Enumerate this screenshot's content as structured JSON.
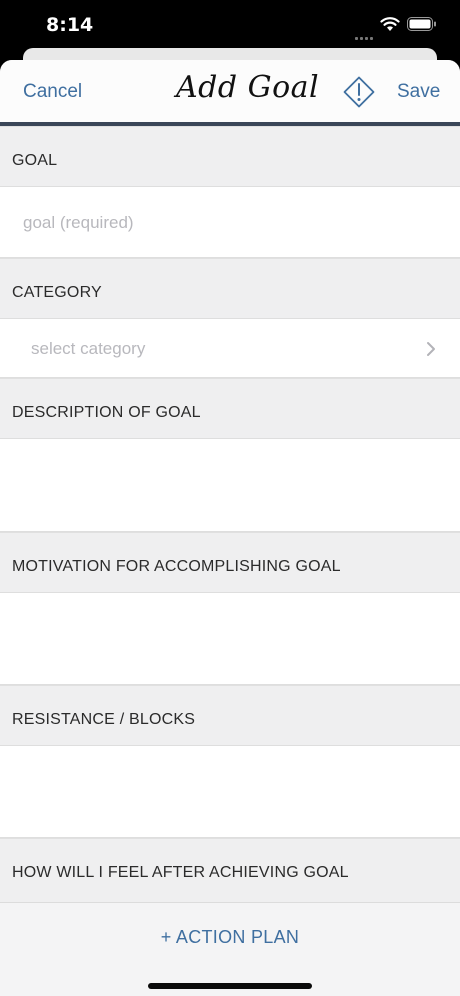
{
  "status": {
    "time": "8:14"
  },
  "nav": {
    "cancel": "Cancel",
    "title": "Add Goal",
    "save": "Save"
  },
  "sections": {
    "goal": {
      "header": "GOAL",
      "placeholder": "goal (required)"
    },
    "category": {
      "header": "CATEGORY",
      "placeholder": "select category"
    },
    "description": {
      "header": "DESCRIPTION OF GOAL"
    },
    "motivation": {
      "header": "MOTIVATION FOR ACCOMPLISHING GOAL"
    },
    "resistance": {
      "header": "RESISTANCE / BLOCKS"
    },
    "feeling": {
      "header": "HOW WILL I FEEL AFTER ACHIEVING GOAL"
    }
  },
  "action": {
    "label": "+ ACTION PLAN"
  },
  "colors": {
    "accent": "#3f6fa0",
    "nav_border": "#3a4658"
  }
}
